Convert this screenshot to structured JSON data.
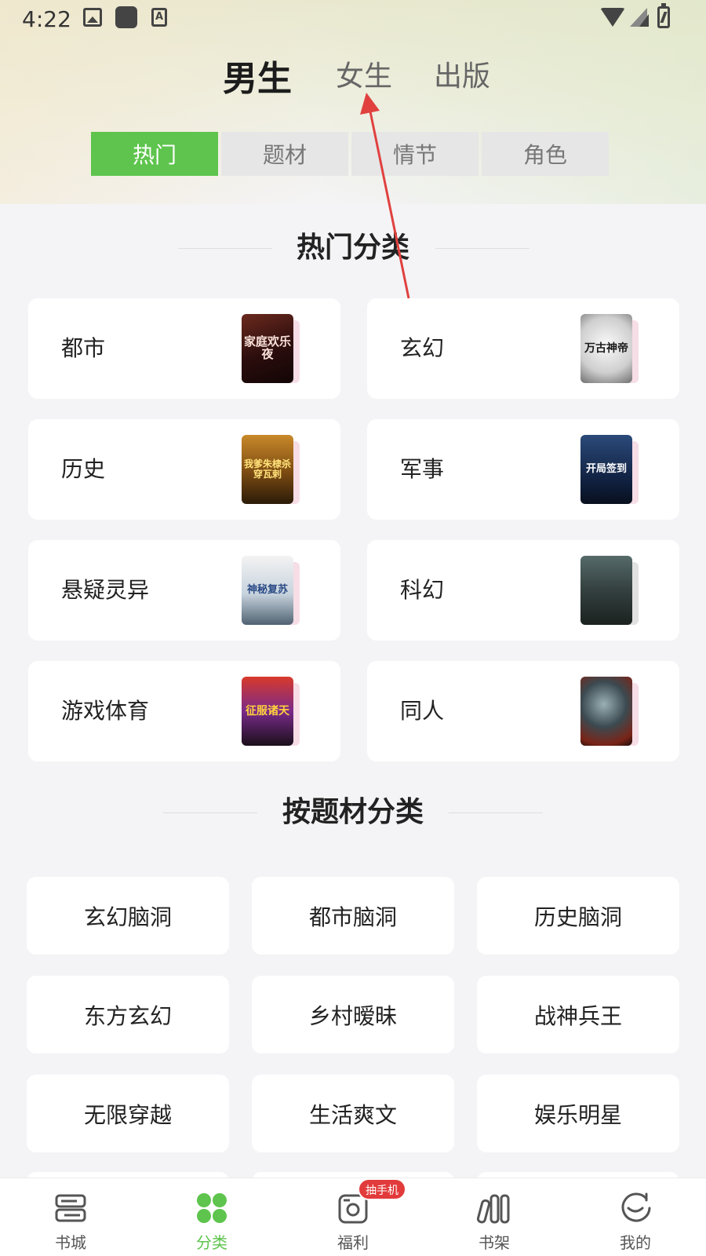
{
  "status_bar": {
    "time": "4:22",
    "icons": [
      "image-icon",
      "app-square-icon",
      "font-a-icon",
      "wifi-icon",
      "signal-icon",
      "battery-icon"
    ]
  },
  "gender_tabs": [
    {
      "label": "男生",
      "active": true
    },
    {
      "label": "女生",
      "active": false
    },
    {
      "label": "出版",
      "active": false
    }
  ],
  "sub_tabs": [
    {
      "label": "热门",
      "active": true
    },
    {
      "label": "题材",
      "active": false
    },
    {
      "label": "情节",
      "active": false
    },
    {
      "label": "角色",
      "active": false
    }
  ],
  "hot_section": {
    "title": "热门分类",
    "items": [
      {
        "label": "都市",
        "cover_text": "家庭欢乐夜"
      },
      {
        "label": "玄幻",
        "cover_text": "万古神帝"
      },
      {
        "label": "历史",
        "cover_text": "我爹朱棣杀穿瓦剌"
      },
      {
        "label": "军事",
        "cover_text": "开局签到"
      },
      {
        "label": "悬疑灵异",
        "cover_text": "神秘复苏"
      },
      {
        "label": "科幻",
        "cover_text": ""
      },
      {
        "label": "游戏体育",
        "cover_text": "征服诸天"
      },
      {
        "label": "同人",
        "cover_text": ""
      }
    ]
  },
  "theme_section": {
    "title": "按题材分类",
    "items": [
      "玄幻脑洞",
      "都市脑洞",
      "历史脑洞",
      "东方玄幻",
      "乡村暧昧",
      "战神兵王",
      "无限穿越",
      "生活爽文",
      "娱乐明星"
    ]
  },
  "bottom_nav": [
    {
      "label": "书城",
      "icon": "bookstore-icon",
      "active": false
    },
    {
      "label": "分类",
      "icon": "category-grid-icon",
      "active": true
    },
    {
      "label": "福利",
      "icon": "welfare-icon",
      "active": false,
      "badge": "抽手机"
    },
    {
      "label": "书架",
      "icon": "bookshelf-icon",
      "active": false
    },
    {
      "label": "我的",
      "icon": "profile-face-icon",
      "active": false
    }
  ],
  "colors": {
    "accent_green": "#5ec44d",
    "badge_red": "#e23b3b",
    "annotation_arrow": "#e0413f"
  }
}
